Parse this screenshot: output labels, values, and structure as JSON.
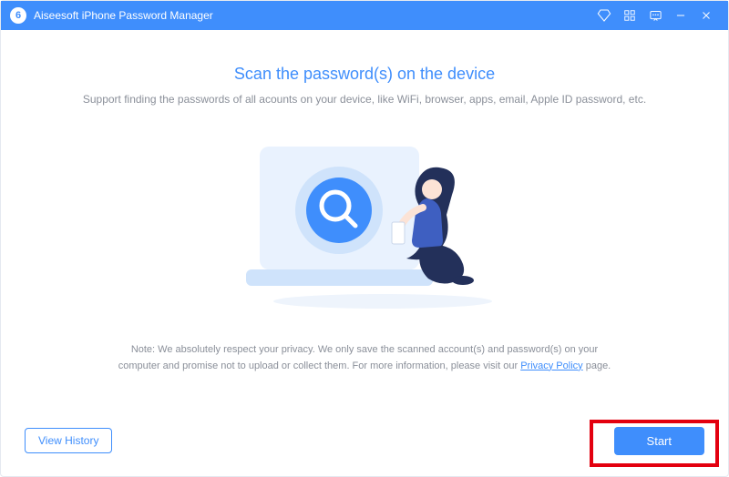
{
  "titlebar": {
    "app_name": "Aiseesoft iPhone Password Manager",
    "logo_glyph": "6"
  },
  "main": {
    "heading": "Scan the password(s) on the device",
    "subtext": "Support finding the passwords of all acounts on your device, like  WiFi, browser, apps, email, Apple ID password, etc.",
    "note_prefix": "Note: We absolutely respect your privacy. We only save the scanned account(s) and password(s) on your computer and promise not to upload or collect them. For more information, please visit our ",
    "note_link": "Privacy Policy",
    "note_suffix": " page."
  },
  "footer": {
    "view_history": "View History",
    "start": "Start"
  }
}
